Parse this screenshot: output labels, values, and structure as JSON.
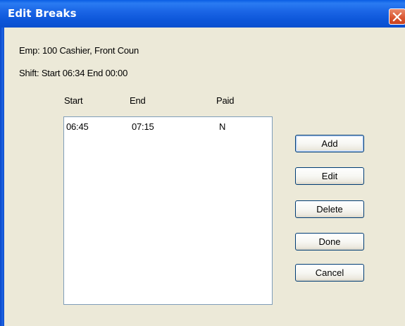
{
  "window": {
    "title": "Edit Breaks"
  },
  "info": {
    "employee": "Emp: 100  Cashier, Front Coun",
    "shift": "Shift: Start 06:34  End 00:00"
  },
  "breaks": {
    "columns": [
      "Start",
      "End",
      "Paid"
    ],
    "rows": [
      {
        "start": "06:45",
        "end": "07:15",
        "paid": "N"
      }
    ]
  },
  "buttons": {
    "add": "Add",
    "edit": "Edit",
    "delete": "Delete",
    "done": "Done",
    "cancel": "Cancel"
  },
  "colors": {
    "titlebar": "#0c55d8",
    "dialog_background": "#ece9d8",
    "close_button": "#d9542f"
  },
  "icons": {
    "close": "close-icon"
  }
}
